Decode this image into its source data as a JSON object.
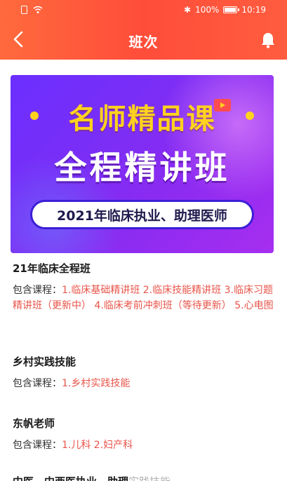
{
  "status_bar": {
    "bluetooth": "✱",
    "battery": "100%",
    "time": "10:19"
  },
  "nav": {
    "title": "班次"
  },
  "banner": {
    "top_text": "名师精品课",
    "main_text": "全程精讲班",
    "pill_text": "2021年临床执业、助理医师"
  },
  "courses": [
    {
      "title": "21年临床全程班",
      "prefix": "包含课程：",
      "items": "1.临床基础精讲班 2.临床技能精讲班 3.临床习题精讲班（更新中） 4.临床考前冲刺班（等待更新） 5.心电图"
    },
    {
      "title": "乡村实践技能",
      "prefix": "包含课程：",
      "items": "1.乡村实践技能"
    },
    {
      "title": "东帆老师",
      "prefix": "包含课程：",
      "items": "1.儿科 2.妇产科"
    },
    {
      "title": "中医、中西医执业、助理",
      "title_faded": "实践技能"
    }
  ],
  "colors": {
    "header_gradient_start": "#ff6a3d",
    "header_gradient_end": "#ff4d3a",
    "course_item": "#e8554a",
    "banner_yellow": "#ffd21f",
    "banner_purple": "#7a2ef6"
  }
}
